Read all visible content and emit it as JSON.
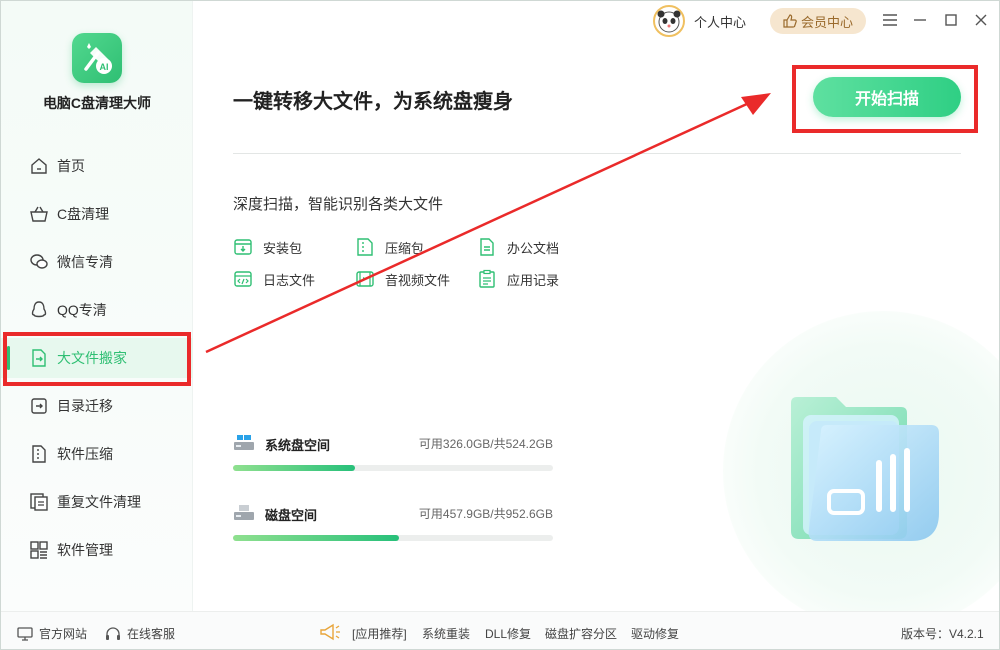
{
  "app": {
    "title": "电脑C盘清理大师"
  },
  "sidebar": {
    "items": [
      {
        "label": "首页",
        "icon": "home-icon"
      },
      {
        "label": "C盘清理",
        "icon": "basket-icon"
      },
      {
        "label": "微信专清",
        "icon": "wechat-icon"
      },
      {
        "label": "QQ专清",
        "icon": "qq-icon"
      },
      {
        "label": "大文件搬家",
        "icon": "file-move-icon",
        "active": true
      },
      {
        "label": "目录迁移",
        "icon": "directory-move-icon"
      },
      {
        "label": "软件压缩",
        "icon": "zip-icon"
      },
      {
        "label": "重复文件清理",
        "icon": "duplicate-files-icon"
      },
      {
        "label": "软件管理",
        "icon": "apps-grid-icon"
      }
    ]
  },
  "topbar": {
    "user_center": "个人中心",
    "vip": "会员中心"
  },
  "main": {
    "headline": "一键转移大文件，为系统盘瘦身",
    "scan_button": "开始扫描",
    "subheading": "深度扫描，智能识别各类大文件",
    "file_types": [
      {
        "label": "安装包",
        "icon": "package-icon"
      },
      {
        "label": "压缩包",
        "icon": "archive-icon"
      },
      {
        "label": "办公文档",
        "icon": "document-icon"
      },
      {
        "label": "日志文件",
        "icon": "code-file-icon"
      },
      {
        "label": "音视频文件",
        "icon": "media-file-icon"
      },
      {
        "label": "应用记录",
        "icon": "clipboard-icon"
      }
    ],
    "disks": [
      {
        "name": "系统盘空间",
        "info": "可用326.0GB/共524.2GB",
        "used_fraction": 0.38
      },
      {
        "name": "磁盘空间",
        "info": "可用457.9GB/共952.6GB",
        "used_fraction": 0.52
      }
    ]
  },
  "footer": {
    "website": "官方网站",
    "support": "在线客服",
    "promo": "[应用推荐]",
    "links": [
      "系统重装",
      "DLL修复",
      "磁盘扩容分区",
      "驱动修复"
    ],
    "version": "版本号：V4.2.1"
  },
  "colors": {
    "accent": "#2fbf73",
    "annotation": "#ea2a2a"
  }
}
